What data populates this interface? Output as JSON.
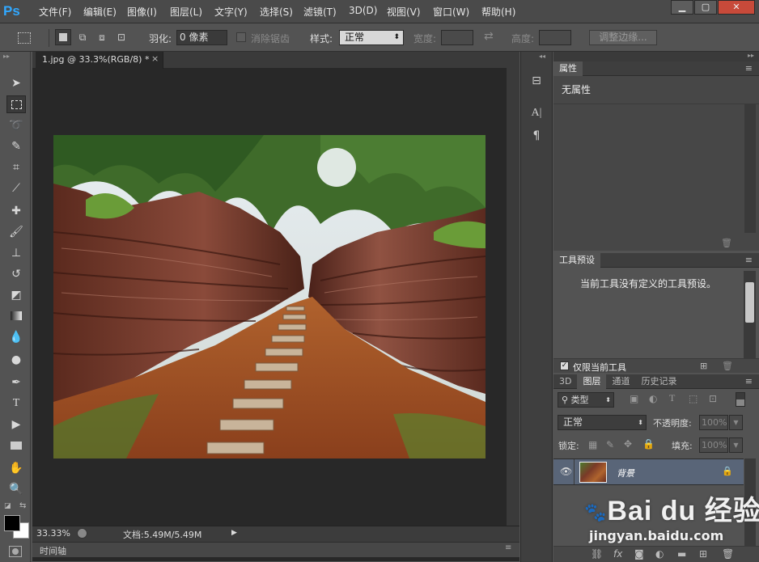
{
  "app": {
    "logo": "Ps",
    "menu": [
      "文件(F)",
      "编辑(E)",
      "图像(I)",
      "图层(L)",
      "文字(Y)",
      "选择(S)",
      "滤镜(T)",
      "3D(D)",
      "视图(V)",
      "窗口(W)",
      "帮助(H)"
    ],
    "window_buttons": [
      "▁",
      "▢",
      "✕"
    ]
  },
  "options": {
    "feather_label": "羽化:",
    "feather_value": "0 像素",
    "antialias_label": "消除锯齿",
    "style_label": "样式:",
    "style_value": "正常",
    "width_label": "宽度:",
    "height_label": "高度:",
    "refine_button": "调整边缘..."
  },
  "document": {
    "tab_title": "1.jpg @ 33.3%(RGB/8) *",
    "tab_close": "×",
    "zoom": "33.33%",
    "doc_info": "文档:5.49M/5.49M",
    "timeline_label": "时间轴"
  },
  "properties_panel": {
    "tab": "属性",
    "content": "无属性"
  },
  "tool_presets_panel": {
    "tab": "工具预设",
    "message": "当前工具没有定义的工具预设。",
    "checkbox_label": "仅限当前工具"
  },
  "layers_panel": {
    "tabs": [
      "3D",
      "图层",
      "通道",
      "历史记录"
    ],
    "active_tab": "图层",
    "filter_value": "类型",
    "blend_mode": "正常",
    "opacity_label": "不透明度:",
    "opacity_value": "100%",
    "lock_label": "锁定:",
    "fill_label": "填充:",
    "fill_value": "100%",
    "layers": [
      {
        "name": "背景",
        "visible": true,
        "locked": true
      }
    ]
  },
  "watermark": {
    "brand": "Bai du 经验",
    "url": "jingyan.baidu.com"
  },
  "colors": {
    "ps_blue": "#31a8ff",
    "selected_layer": "#596578",
    "canvas_bg": "#282828"
  }
}
